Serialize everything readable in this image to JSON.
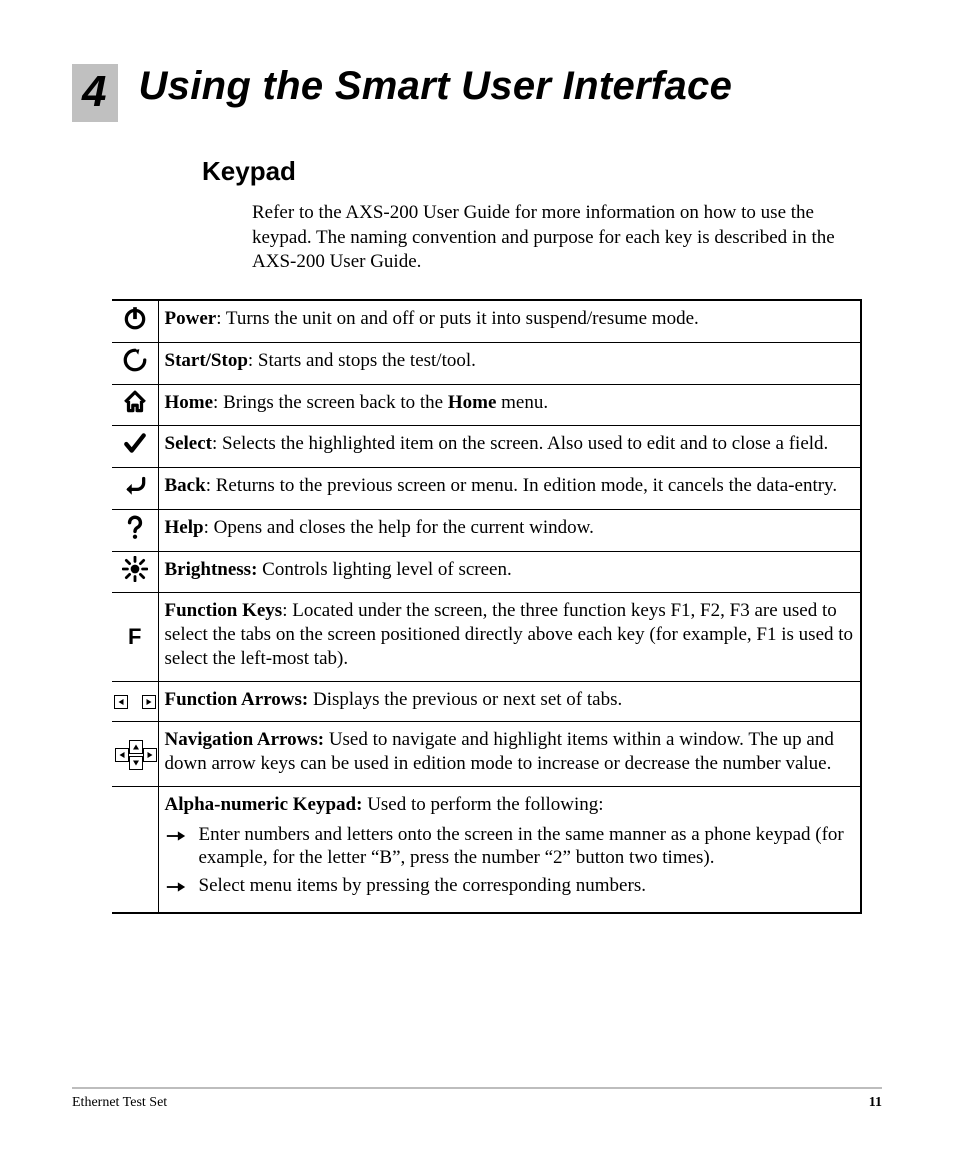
{
  "chapter": {
    "number": "4",
    "title": "Using the Smart User Interface"
  },
  "section": {
    "heading": "Keypad"
  },
  "intro": "Refer to the AXS-200 User Guide for more information on how to use the keypad. The naming convention and purpose for each key is described in the AXS-200 User Guide.",
  "rows": {
    "power": {
      "label": "Power",
      "text": ": Turns the unit on and off or puts it into suspend/resume mode."
    },
    "startstop": {
      "label": "Start/Stop",
      "text": ": Starts and stops the test/tool."
    },
    "home": {
      "label": "Home",
      "pre": ": Brings the screen back to the ",
      "mid": "Home",
      "post": " menu."
    },
    "select": {
      "label": "Select",
      "text": ": Selects the highlighted item on the screen. Also used to edit and to close a field."
    },
    "back": {
      "label": "Back",
      "text": ": Returns to the previous screen or menu. In edition mode, it cancels the data-entry."
    },
    "help": {
      "label": "Help",
      "text": ": Opens and closes the help for the current window."
    },
    "brightness": {
      "label": "Brightness:",
      "text": " Controls lighting level of screen."
    },
    "fkeys": {
      "label": "Function Keys",
      "text": ": Located under the screen, the three function keys F1, F2, F3 are used to select the tabs on the screen positioned directly above each key (for example, F1 is used to select the left-most tab)."
    },
    "farrows": {
      "label": "Function Arrows:",
      "text": " Displays the previous or next set of tabs."
    },
    "navarrows": {
      "label": "Navigation Arrows:",
      "text": " Used to navigate and highlight items within a window. The up and down arrow keys can be used in edition mode to increase or decrease the number value."
    },
    "alnum": {
      "label": "Alpha-numeric Keypad:",
      "text": " Used to perform the following:",
      "b1": "Enter numbers and letters onto the screen in the same manner as a phone keypad (for example, for the letter “B”, press the number “2” button two times).",
      "b2": "Select menu items by pressing the corresponding numbers."
    }
  },
  "fkey_letter": "F",
  "footer": {
    "left": "Ethernet Test Set",
    "page": "11"
  }
}
